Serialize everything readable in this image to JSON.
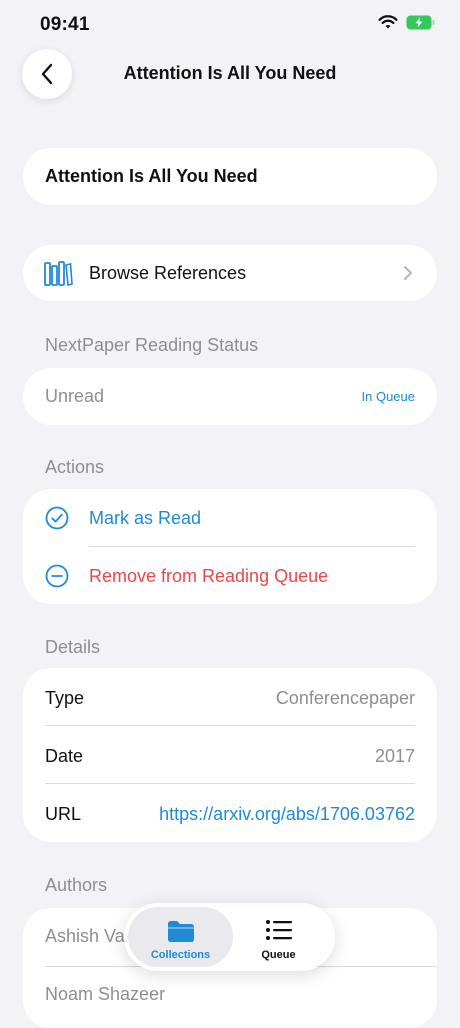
{
  "status_bar": {
    "time": "09:41"
  },
  "nav": {
    "title": "Attention Is All You Need"
  },
  "paper": {
    "title": "Attention Is All You Need"
  },
  "browse": {
    "label": "Browse References"
  },
  "reading_status": {
    "header": "NextPaper Reading Status",
    "value": "Unread",
    "badge": "In Queue"
  },
  "actions": {
    "header": "Actions",
    "mark_read": "Mark as Read",
    "remove": "Remove from Reading Queue"
  },
  "details": {
    "header": "Details",
    "rows": [
      {
        "label": "Type",
        "value": "Conferencepaper"
      },
      {
        "label": "Date",
        "value": "2017"
      },
      {
        "label": "URL",
        "value": "https://arxiv.org/abs/1706.03762"
      }
    ]
  },
  "authors": {
    "header": "Authors",
    "items": [
      "Ashish Vaswani",
      "Noam Shazeer"
    ]
  },
  "tabs": [
    {
      "label": "Collections",
      "icon": "folder-icon"
    },
    {
      "label": "Queue",
      "icon": "list-icon"
    }
  ],
  "colors": {
    "accent": "#1f8ad6",
    "destructive": "#e5484d",
    "battery": "#34c759"
  }
}
